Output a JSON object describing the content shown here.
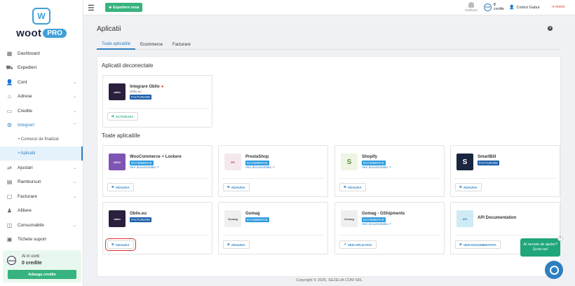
{
  "brand": {
    "logo_word": "woot",
    "logo_pro": "PRO"
  },
  "sidebar": {
    "items": [
      {
        "label": "Dashboard",
        "icon": "dashboard-icon",
        "chevron": false
      },
      {
        "label": "Expedieri",
        "icon": "truck-icon",
        "chevron": false
      },
      {
        "label": "Cont",
        "icon": "user-icon",
        "chevron": true
      },
      {
        "label": "Adrese",
        "icon": "home-icon",
        "chevron": true
      },
      {
        "label": "Credite",
        "icon": "wallet-icon",
        "chevron": true
      },
      {
        "label": "Integrari",
        "icon": "integrations-icon",
        "chevron": true
      }
    ],
    "sub_items": [
      {
        "label": "• Comenzi de finalizat"
      },
      {
        "label": "• Aplicatii"
      }
    ],
    "items2": [
      {
        "label": "Ajustari",
        "icon": "adjust-icon",
        "chevron": true
      },
      {
        "label": "Rambursuri",
        "icon": "money-icon",
        "chevron": true
      },
      {
        "label": "Facturare",
        "icon": "invoice-icon",
        "chevron": true
      },
      {
        "label": "Afiliere",
        "icon": "affiliate-icon",
        "chevron": false
      },
      {
        "label": "Consumabile",
        "icon": "box-icon",
        "chevron": true
      },
      {
        "label": "Tichete suport",
        "icon": "ticket-icon",
        "chevron": false
      }
    ],
    "credit": {
      "label": "Ai in cont:",
      "value": "0 credite",
      "button": "Adauga credite",
      "badge": "woot"
    }
  },
  "topbar": {
    "ship_button": "Expediere noua",
    "notifications": "Notificari",
    "credits_count": "0",
    "credits_label": "credite",
    "credits_badge": "woot",
    "user": "Codrut Gabur",
    "logout": "Iesire"
  },
  "main": {
    "title": "Aplicatii",
    "help": "?",
    "tabs": [
      "Toate aplicatiile",
      "Ecommerce",
      "Facturare"
    ],
    "disconnected_title": "Aplicatii deconectate",
    "all_title": "Toate aplicatiile",
    "disconnected_card": {
      "name": "Integrare Oblio",
      "dot": "●",
      "sub": "Oblio.eu",
      "badge": "FACTURARE",
      "logo_text": "oblio",
      "button": "ACTIVEAZA"
    },
    "cards": [
      {
        "name": "WooCommerce + Lockere",
        "badge": "ECOMMERCE",
        "link": "Vezi documentatia",
        "button": "ADAUGA",
        "logo_text": "WOO"
      },
      {
        "name": "PrestaShop",
        "badge": "ECOMMERCE",
        "link": "Vezi documentatia",
        "button": "ADAUGA",
        "logo_text": "PS"
      },
      {
        "name": "Shopify",
        "badge": "ECOMMERCE",
        "link": "Vezi documentatia",
        "button": "ADAUGA",
        "logo_text": "S"
      },
      {
        "name": "SmartBill",
        "badge": "FACTURARE",
        "link": "",
        "button": "ADAUGA",
        "logo_text": "S"
      },
      {
        "name": "Oblio.eu",
        "badge": "FACTURARE",
        "link": "",
        "button": "ADAUGA",
        "logo_text": "oblio"
      },
      {
        "name": "Gomag",
        "badge": "ECOMMERCE",
        "link": "",
        "button": "ADAUGA",
        "logo_text": "Gomag"
      },
      {
        "name": "Gomag - GShipments",
        "badge": "ECOMMERCE",
        "link": "Vezi documentatia",
        "button": "VEZI APLICATIA",
        "logo_text": "Gomag"
      },
      {
        "name": "API Documentation",
        "badge": "",
        "link": "",
        "button": "VEZI DOCUMENTATIA",
        "logo_text": "API"
      }
    ]
  },
  "footer": "Copyright © 2025, SEZELIA COM SRL",
  "chat": {
    "bubble": "Ai nevoie de ajutor? Scrie-ne!",
    "close": "×"
  },
  "colors": {
    "accent": "#2d7fc1",
    "green": "#36b37e",
    "oblio": "#2a1f3d",
    "woo": "#7f54b3",
    "smartbill": "#1a2540"
  }
}
